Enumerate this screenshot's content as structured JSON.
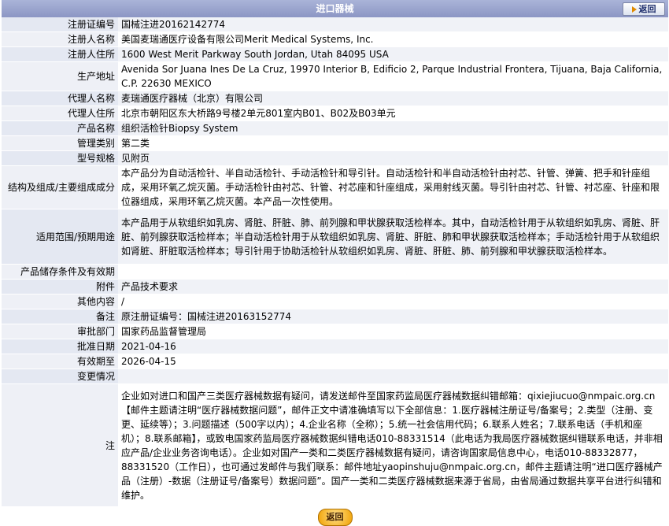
{
  "header": {
    "title": "进口器械",
    "back_label": "返回"
  },
  "rows": [
    {
      "label": "注册证编号",
      "value": "国械注进20162142774"
    },
    {
      "label": "注册人名称",
      "value": "美国麦瑞通医疗设备有限公司Merit Medical Systems, Inc."
    },
    {
      "label": "注册人住所",
      "value": "1600 West Merit Parkway South Jordan, Utah 84095 USA"
    },
    {
      "label": "生产地址",
      "value": "Avenida Sor Juana Ines De La Cruz, 19970 Interior B, Edificio 2, Parque Industrial Frontera, Tijuana, Baja California, C.P. 22630 MEXICO"
    },
    {
      "label": "代理人名称",
      "value": "麦瑞通医疗器械（北京）有限公司"
    },
    {
      "label": "代理人住所",
      "value": "北京市朝阳区东大桥路9号楼2单元801室内B01、B02及B03单元"
    },
    {
      "label": "产品名称",
      "value": "组织活检针Biopsy System"
    },
    {
      "label": "管理类别",
      "value": "第二类"
    },
    {
      "label": "型号规格",
      "value": "见附页"
    },
    {
      "label": "结构及组成/主要组成成分",
      "value": "本产品分为自动活检针、半自动活检针、手动活检针和导引针。自动活检针和半自动活检针由衬芯、针管、弹簧、把手和针座组成，采用环氧乙烷灭菌。手动活检针由衬芯、针管、衬芯座和针座组成，采用射线灭菌。导引针由衬芯、针管、衬芯座、针座和限位器组成，采用环氧乙烷灭菌。本产品一次性使用。"
    },
    {
      "label": "适用范围/预期用途",
      "value": "本产品用于从软组织如乳房、肾脏、肝脏、肺、前列腺和甲状腺获取活检样本。其中，自动活检针用于从软组织如乳房、肾脏、肝脏、前列腺获取活检样本；半自动活检针用于从软组织如乳房、肾脏、肝脏、肺和甲状腺获取活检样本；手动活检针用于从软组织如肾脏、肝脏取活检样本；导引针用于协助活检针从软组织如乳房、肾脏、肝脏、肺、前列腺和甲状腺获取活检样本。"
    },
    {
      "label": "产品储存条件及有效期",
      "value": ""
    },
    {
      "label": "附件",
      "value": "产品技术要求"
    },
    {
      "label": "其他内容",
      "value": "/"
    },
    {
      "label": "备注",
      "value": "原注册证编号：国械注进20163152774"
    },
    {
      "label": "审批部门",
      "value": "国家药品监督管理局"
    },
    {
      "label": "批准日期",
      "value": "2021-04-16"
    },
    {
      "label": "有效期至",
      "value": "2026-04-15"
    },
    {
      "label": "变更情况",
      "value": ""
    },
    {
      "label": "注",
      "value": "企业如对进口和国产三类医疗器械数据有疑问，请发送邮件至国家药监局医疗器械数据纠错邮箱：qixiejiucuo@nmpaic.org.cn【邮件主题请注明“医疗器械数据问题”，邮件正文中请准确填写以下全部信息：1.医疗器械注册证号/备案号；2.类型（注册、变更、延续等）；3.问题描述（500字以内）；4.企业名称（全称）；5.统一社会信用代码；6.联系人姓名；7.联系电话（手机和座机）；8.联系邮箱】，或致电国家药监局医疗器械数据纠错电话010-88331514（此电话为我局医疗器械数据纠错联系电话，并非相应产品/企业业务咨询电话）。企业如对国产一类和二类医疗器械数据有疑问，请咨询国家局信息中心，电话010-88332877，88331520（工作日），也可通过发邮件与我们联系：邮件地址yaopinshuju@nmpaic.org.cn，邮件主题请注明“进口医疗器械产品（注册）-数据（注册证号/备案号）数据问题”。国产一类和二类医疗器械数据来源于省局，由省局通过数据共享平台进行纠错和维护。"
    }
  ],
  "footer": {
    "back_label": "返回"
  },
  "colors": {
    "title_bar": "#9aa4d0",
    "label_cell": "#e8ecf4",
    "back_button": "#f0a000"
  }
}
